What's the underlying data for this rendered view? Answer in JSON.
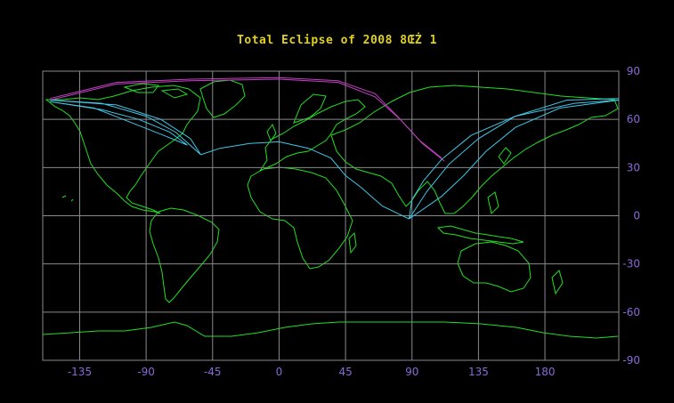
{
  "title": "Total  Eclipse  of  2008  8ŒŻ  1",
  "colors": {
    "background": "#000000",
    "title": "#e0d020",
    "grid": "#8a8a8a",
    "coastline": "#20e020",
    "tick_labels": "#8a6ad8",
    "umbra_path": "#c040c0",
    "penumbra_path": "#40c8e8"
  },
  "axes": {
    "lon_range": [
      -160,
      230
    ],
    "lat_range": [
      -90,
      90
    ],
    "x_ticks": [
      "-135",
      "-90",
      "-45",
      "0",
      "45",
      "90",
      "135",
      "180"
    ],
    "x_tick_values": [
      -135,
      -90,
      -45,
      0,
      45,
      90,
      135,
      180
    ],
    "y_ticks": [
      "90",
      "60",
      "30",
      "0",
      "-30",
      "-60",
      "-90"
    ],
    "y_tick_values": [
      90,
      60,
      30,
      0,
      -30,
      -60,
      -90
    ],
    "grid": true
  },
  "paths": {
    "umbra": [
      {
        "name": "north",
        "points": [
          [
            -155,
            73
          ],
          [
            -110,
            83
          ],
          [
            -60,
            85
          ],
          [
            0,
            86
          ],
          [
            40,
            84
          ],
          [
            65,
            76
          ],
          [
            80,
            62
          ],
          [
            95,
            47
          ],
          [
            110,
            36
          ]
        ]
      },
      {
        "name": "south",
        "points": [
          [
            -155,
            72
          ],
          [
            -110,
            82
          ],
          [
            -60,
            84
          ],
          [
            0,
            85
          ],
          [
            40,
            83
          ],
          [
            65,
            74
          ],
          [
            82,
            60
          ],
          [
            97,
            45
          ],
          [
            112,
            34
          ]
        ]
      }
    ],
    "penumbra": [
      {
        "name": "outer-loop-west",
        "points": [
          [
            -155,
            72
          ],
          [
            -120,
            70
          ],
          [
            -90,
            62
          ],
          [
            -70,
            52
          ],
          [
            -53,
            38
          ],
          [
            -60,
            48
          ],
          [
            -80,
            60
          ],
          [
            -110,
            69
          ],
          [
            -155,
            72
          ]
        ]
      },
      {
        "name": "mid-loop-west",
        "points": [
          [
            -155,
            71
          ],
          [
            -125,
            67
          ],
          [
            -100,
            58
          ],
          [
            -78,
            50
          ],
          [
            -62,
            44
          ],
          [
            -74,
            52
          ],
          [
            -95,
            60
          ],
          [
            -120,
            66
          ],
          [
            -155,
            71
          ]
        ]
      },
      {
        "name": "south-limit",
        "points": [
          [
            -53,
            38
          ],
          [
            -40,
            42
          ],
          [
            -20,
            45
          ],
          [
            0,
            46
          ],
          [
            20,
            42
          ],
          [
            35,
            36
          ],
          [
            45,
            25
          ],
          [
            55,
            18
          ],
          [
            70,
            6
          ],
          [
            88,
            -2
          ]
        ]
      },
      {
        "name": "outer-loop-east",
        "points": [
          [
            88,
            -2
          ],
          [
            100,
            15
          ],
          [
            115,
            32
          ],
          [
            135,
            48
          ],
          [
            160,
            62
          ],
          [
            195,
            72
          ],
          [
            230,
            73
          ]
        ]
      },
      {
        "name": "inner-loop-east-a",
        "points": [
          [
            88,
            -2
          ],
          [
            110,
            12
          ],
          [
            125,
            25
          ],
          [
            140,
            40
          ],
          [
            160,
            55
          ],
          [
            190,
            67
          ],
          [
            230,
            72
          ]
        ]
      },
      {
        "name": "inner-loop-east-b",
        "points": [
          [
            88,
            -2
          ],
          [
            90,
            10
          ],
          [
            98,
            22
          ],
          [
            110,
            35
          ],
          [
            130,
            50
          ],
          [
            160,
            62
          ],
          [
            200,
            70
          ],
          [
            230,
            72
          ]
        ]
      }
    ]
  }
}
